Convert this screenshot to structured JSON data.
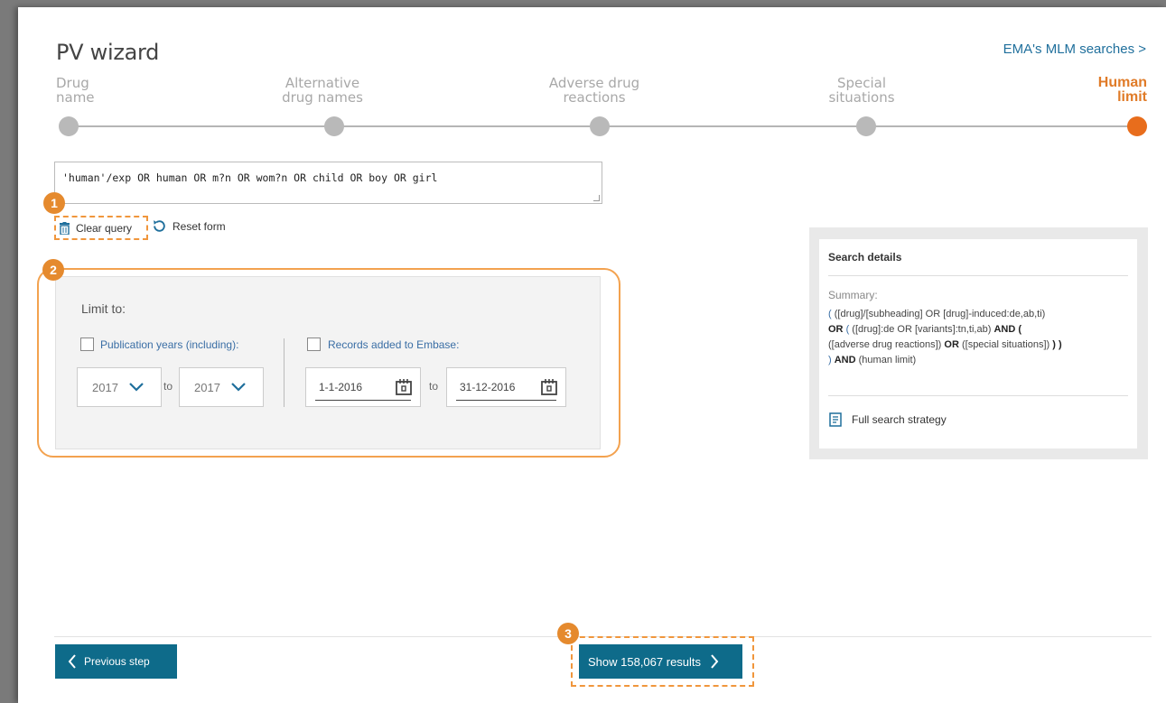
{
  "header": {
    "title": "PV wizard",
    "ema_link": "EMA's MLM searches >"
  },
  "steps": [
    {
      "line1": "Drug",
      "line2": "name",
      "active": false
    },
    {
      "line1": "Alternative",
      "line2": "drug names",
      "active": false
    },
    {
      "line1": "Adverse drug",
      "line2": "reactions",
      "active": false
    },
    {
      "line1": "Special",
      "line2": "situations",
      "active": false
    },
    {
      "line1": "Human",
      "line2": "limit",
      "active": true
    }
  ],
  "query": {
    "text": "'human'/exp OR human OR m?n OR wom?n OR child OR boy OR girl"
  },
  "actions": {
    "clear_query": "Clear query",
    "reset_form": "Reset form"
  },
  "limit": {
    "title": "Limit to:",
    "publication_years_label": "Publication years (including):",
    "year_from": "2017",
    "year_to": "2017",
    "to_label": "to",
    "records_added_label": "Records added to Embase:",
    "date_from": "1-1-2016",
    "date_to": "31-12-2016"
  },
  "details": {
    "title": "Search details",
    "summary_label": "Summary:",
    "summary": {
      "l1_paren": "(",
      "l1_text": "([drug]/[subheading] OR [drug]-induced:de,ab,ti)",
      "l2_or": "OR",
      "l2_paren": "(",
      "l2_text": "([drug]:de OR [variants]:tn,ti,ab)",
      "l2_and": "AND (",
      "l3_text": "([adverse drug reactions])",
      "l3_or": "OR",
      "l3_text2": "([special situations])",
      "l3_close": ") )",
      "l4_paren": ")",
      "l4_and": "AND",
      "l4_text": "(human limit)"
    },
    "full_strategy": "Full search strategy"
  },
  "footer": {
    "previous": "Previous step",
    "show_results": "Show 158,067 results"
  },
  "badges": [
    "1",
    "2",
    "3"
  ],
  "colors": {
    "accent_orange": "#e86d1c",
    "button_teal": "#0e6b8a",
    "link_blue": "#1f6f9c",
    "annotation_orange": "#f0963c"
  }
}
